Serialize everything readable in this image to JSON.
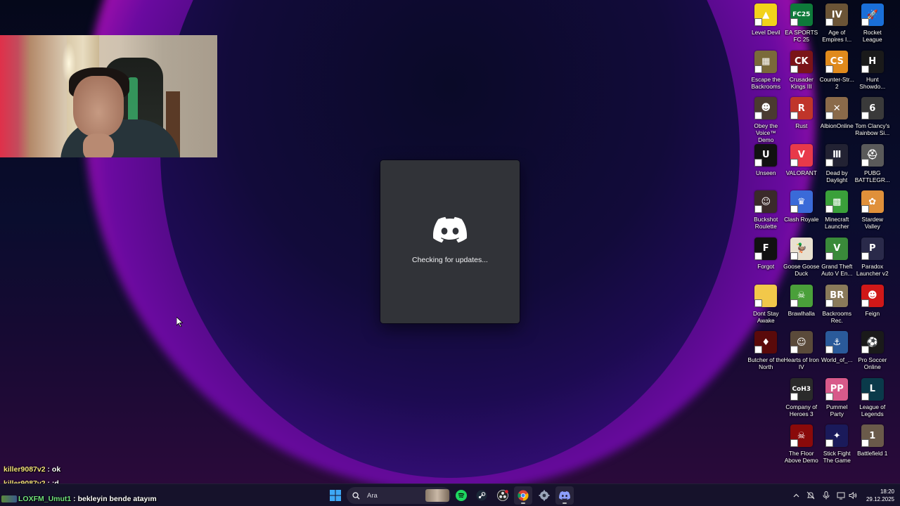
{
  "desktop": {
    "icons": [
      {
        "label": "Level Devil",
        "icon": "level-devil-icon",
        "color": "#f2d21a",
        "glyph": "▲"
      },
      {
        "label": "EA SPORTS FC 25",
        "icon": "ea-fc25-icon",
        "color": "#0e7a3a",
        "glyph": "FC25"
      },
      {
        "label": "Age of Empires I...",
        "icon": "age-of-empires-icon",
        "color": "#6b5436",
        "glyph": "IV"
      },
      {
        "label": "Rocket League",
        "icon": "rocket-league-icon",
        "color": "#1a6fd8",
        "glyph": "🚀"
      },
      {
        "label": "Escape the Backrooms",
        "icon": "escape-backrooms-icon",
        "color": "#7a6a3a",
        "glyph": "▦"
      },
      {
        "label": "Crusader Kings III",
        "icon": "crusader-kings-icon",
        "color": "#7a1418",
        "glyph": "CK"
      },
      {
        "label": "Counter-Str... 2",
        "icon": "counter-strike-icon",
        "color": "#e08a1c",
        "glyph": "CS"
      },
      {
        "label": "Hunt Showdo...",
        "icon": "hunt-showdown-icon",
        "color": "#1a1a1a",
        "glyph": "H"
      },
      {
        "label": "Obey the Voice™ Demo",
        "icon": "obey-the-voice-icon",
        "color": "#4a3a30",
        "glyph": "☻"
      },
      {
        "label": "Rust",
        "icon": "rust-icon",
        "color": "#c0352a",
        "glyph": "R"
      },
      {
        "label": "AlbionOnline",
        "icon": "albion-online-icon",
        "color": "#8a6a4a",
        "glyph": "✕"
      },
      {
        "label": "Tom Clancy's Rainbow Si...",
        "icon": "rainbow-six-icon",
        "color": "#3a3a3a",
        "glyph": "6"
      },
      {
        "label": "Unseen",
        "icon": "unseen-icon",
        "color": "#111111",
        "glyph": "U"
      },
      {
        "label": "VALORANT",
        "icon": "valorant-icon",
        "color": "#e83a4a",
        "glyph": "V"
      },
      {
        "label": "Dead by Daylight",
        "icon": "dead-by-daylight-icon",
        "color": "#222233",
        "glyph": "Ⅲ"
      },
      {
        "label": "PUBG BATTLEGR...",
        "icon": "pubg-icon",
        "color": "#5a5a5a",
        "glyph": "⛑"
      },
      {
        "label": "Buckshot Roulette",
        "icon": "buckshot-roulette-icon",
        "color": "#3a2a2a",
        "glyph": "☺"
      },
      {
        "label": "Clash Royale",
        "icon": "clash-royale-icon",
        "color": "#3a6ad8",
        "glyph": "♛"
      },
      {
        "label": "Minecraft Launcher",
        "icon": "minecraft-icon",
        "color": "#3aa03a",
        "glyph": "▩"
      },
      {
        "label": "Stardew Valley",
        "icon": "stardew-valley-icon",
        "color": "#e0903a",
        "glyph": "✿"
      },
      {
        "label": "Forgot",
        "icon": "forgot-icon",
        "color": "#111111",
        "glyph": "F"
      },
      {
        "label": "Goose Goose Duck",
        "icon": "goose-goose-duck-icon",
        "color": "#e8e0d0",
        "glyph": "🦆"
      },
      {
        "label": "Grand Theft Auto V En...",
        "icon": "gta-v-icon",
        "color": "#3a8a3a",
        "glyph": "V"
      },
      {
        "label": "Paradox Launcher v2",
        "icon": "paradox-launcher-icon",
        "color": "#2a2a4a",
        "glyph": "P"
      },
      {
        "label": "Dont Stay Awake",
        "icon": "folder-icon",
        "color": "#f2c84a",
        "glyph": ""
      },
      {
        "label": "Brawlhalla",
        "icon": "brawlhalla-icon",
        "color": "#4aa03a",
        "glyph": "☠"
      },
      {
        "label": "Backrooms Rec.",
        "icon": "backrooms-rec-icon",
        "color": "#8a7a5a",
        "glyph": "BR"
      },
      {
        "label": "Feign",
        "icon": "feign-icon",
        "color": "#d01818",
        "glyph": "☻"
      },
      {
        "label": "Butcher of the North",
        "icon": "butcher-of-the-north-icon",
        "color": "#5a0a0a",
        "glyph": "♦"
      },
      {
        "label": "Hearts of Iron IV",
        "icon": "hearts-of-iron-icon",
        "color": "#5a4a3a",
        "glyph": "☺"
      },
      {
        "label": "World_of_...",
        "icon": "world-of-warships-icon",
        "color": "#2a5a9a",
        "glyph": "⚓"
      },
      {
        "label": "Pro Soccer Online",
        "icon": "pro-soccer-online-icon",
        "color": "#1a1a1a",
        "glyph": "⚽"
      },
      {
        "label": "",
        "icon": "",
        "color": "",
        "glyph": ""
      },
      {
        "label": "Company of Heroes 3",
        "icon": "company-of-heroes-icon",
        "color": "#2a2a2a",
        "glyph": "CoH3"
      },
      {
        "label": "Pummel Party",
        "icon": "pummel-party-icon",
        "color": "#d85a8a",
        "glyph": "PP"
      },
      {
        "label": "League of Legends",
        "icon": "league-of-legends-icon",
        "color": "#0a3a4a",
        "glyph": "L"
      },
      {
        "label": "",
        "icon": "",
        "color": "",
        "glyph": ""
      },
      {
        "label": "The Floor Above Demo",
        "icon": "floor-above-icon",
        "color": "#8a0a0a",
        "glyph": "☠"
      },
      {
        "label": "Stick Fight The Game",
        "icon": "stick-fight-icon",
        "color": "#1a1a5a",
        "glyph": "✦"
      },
      {
        "label": "Battlefield 1",
        "icon": "battlefield-icon",
        "color": "#6a5a4a",
        "glyph": "1"
      }
    ]
  },
  "splash": {
    "status": "Checking for updates...",
    "logo_color": "#ffffff",
    "bg_color": "#313338"
  },
  "chat": [
    {
      "user": "killer9087v2",
      "sep": " : ",
      "message": "ok"
    },
    {
      "user": "killer9087v2",
      "sep": " : ",
      "message": ":d"
    },
    {
      "user": "LOXFM_Umut1",
      "sep": " : ",
      "message": "bekleyin bende atayım"
    }
  ],
  "taskbar": {
    "search_placeholder": "Ara",
    "time": "18:20",
    "date": "29.12.2025",
    "apps": [
      "start-icon",
      "search-icon",
      "spotify-icon",
      "steam-icon",
      "obs-icon",
      "chrome-icon",
      "settings-app-icon",
      "discord-icon"
    ]
  },
  "webcam": {
    "label": "webcam-overlay"
  }
}
